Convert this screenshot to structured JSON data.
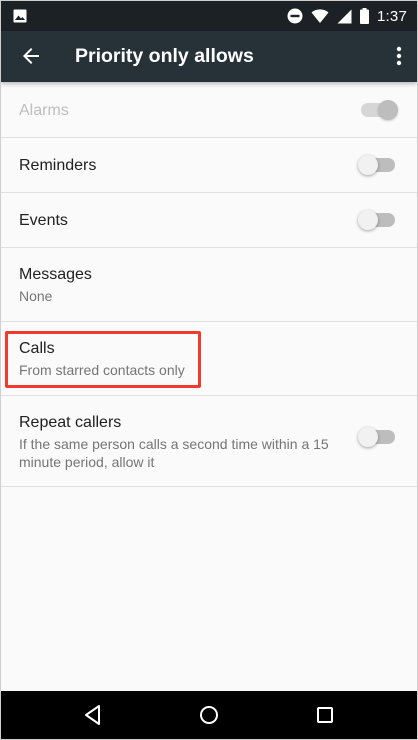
{
  "status_bar": {
    "left_icon": "image-icon",
    "icons": [
      "do-not-disturb-icon",
      "wifi-icon",
      "cellular-signal-icon",
      "battery-icon"
    ],
    "time": "1:37"
  },
  "app_bar": {
    "back_icon": "arrow-back-icon",
    "title": "Priority only allows",
    "menu_icon": "more-vert-icon"
  },
  "settings": {
    "alarms": {
      "title": "Alarms",
      "toggle_on": true,
      "enabled": false
    },
    "reminders": {
      "title": "Reminders",
      "toggle_on": false
    },
    "events": {
      "title": "Events",
      "toggle_on": false
    },
    "messages": {
      "title": "Messages",
      "value": "None"
    },
    "calls": {
      "title": "Calls",
      "value": "From starred contacts only",
      "highlighted": true
    },
    "repeat_callers": {
      "title": "Repeat callers",
      "description": "If the same person calls a second time within a 15 minute period, allow it",
      "toggle_on": false
    }
  },
  "nav_bar": {
    "icons": [
      "back-triangle-icon",
      "home-circle-icon",
      "recents-square-icon"
    ]
  },
  "colors": {
    "status_bar": "#1b2125",
    "app_bar": "#263238",
    "highlight": "#f23a2f",
    "background": "#fafafa"
  }
}
